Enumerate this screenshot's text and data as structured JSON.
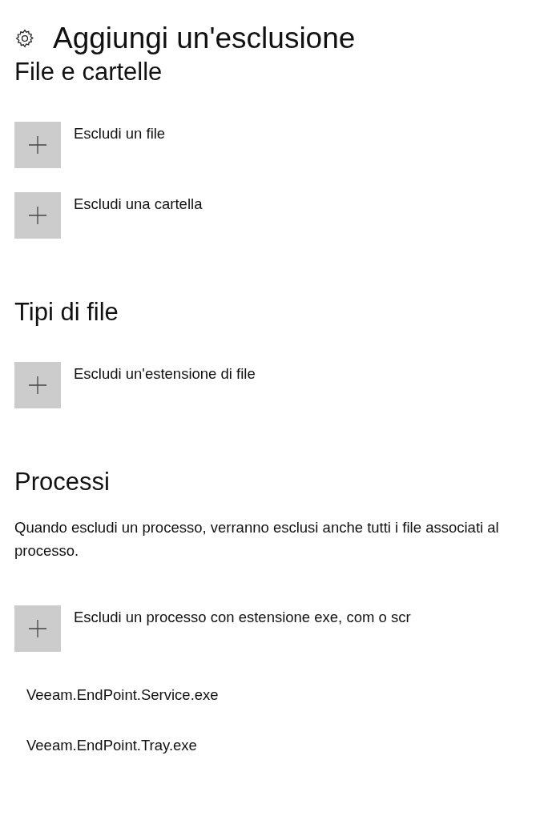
{
  "page": {
    "title": "Aggiungi un'esclusione"
  },
  "sections": [
    {
      "heading": "File e cartelle",
      "actions": [
        {
          "label": "Escludi un file"
        },
        {
          "label": "Escludi una cartella"
        }
      ]
    },
    {
      "heading": "Tipi di file",
      "actions": [
        {
          "label": "Escludi un'estensione di file"
        }
      ]
    },
    {
      "heading": "Processi",
      "description": "Quando escludi un processo, verranno esclusi anche tutti i file associati al processo.",
      "actions": [
        {
          "label": "Escludi un processo con estensione exe, com o scr"
        }
      ],
      "items": [
        "Veeam.EndPoint.Service.exe",
        "Veeam.EndPoint.Tray.exe"
      ]
    }
  ]
}
